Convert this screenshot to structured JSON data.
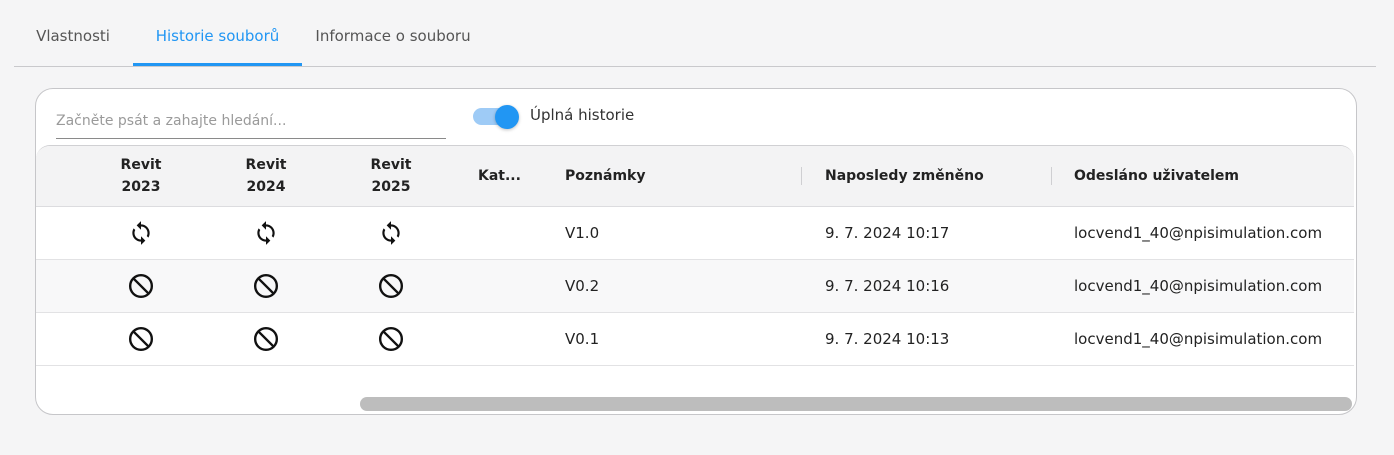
{
  "tabs": [
    {
      "label": "Vlastnosti",
      "active": false
    },
    {
      "label": "Historie souborů",
      "active": true
    },
    {
      "label": "Informace o souboru",
      "active": false
    }
  ],
  "search": {
    "placeholder": "Začněte psát a zahajte hledání...",
    "value": ""
  },
  "toggle": {
    "label": "Úplná historie",
    "on": true
  },
  "colors": {
    "accent": "#2196f3",
    "accent_light": "#9ecbf6"
  },
  "table": {
    "headers": {
      "revit2023": [
        "Revit",
        "2023"
      ],
      "revit2024": [
        "Revit",
        "2024"
      ],
      "revit2025": [
        "Revit",
        "2025"
      ],
      "category": "Kat...",
      "notes": "Poznámky",
      "modified": "Naposledy změněno",
      "sent_by": "Odesláno uživatelem"
    },
    "rows": [
      {
        "r2023": "sync-icon",
        "r2024": "sync-icon",
        "r2025": "sync-icon",
        "category": "",
        "notes": "V1.0",
        "modified": "9. 7. 2024 10:17",
        "sent_by": "locvend1_40@npisimulation.com"
      },
      {
        "r2023": "blocked-icon",
        "r2024": "blocked-icon",
        "r2025": "blocked-icon",
        "category": "",
        "notes": "V0.2",
        "modified": "9. 7. 2024 10:16",
        "sent_by": "locvend1_40@npisimulation.com"
      },
      {
        "r2023": "blocked-icon",
        "r2024": "blocked-icon",
        "r2025": "blocked-icon",
        "category": "",
        "notes": "V0.1",
        "modified": "9. 7. 2024 10:13",
        "sent_by": "locvend1_40@npisimulation.com"
      }
    ]
  }
}
